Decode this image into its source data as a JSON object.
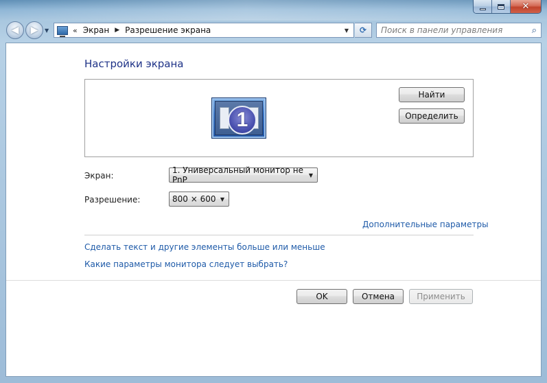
{
  "window": {
    "caption": {
      "minimize": "minimize",
      "maximize": "maximize",
      "close": "✕"
    }
  },
  "navbar": {
    "back_glyph": "◀",
    "forward_glyph": "▶",
    "address_root_sep": "«",
    "breadcrumbs": [
      "Экран",
      "Разрешение экрана"
    ],
    "crumb_arrow": "▶",
    "refresh_glyph": "⟳",
    "search_placeholder": "Поиск в панели управления",
    "search_glyph": "⌕"
  },
  "main": {
    "title": "Настройки экрана",
    "preview": {
      "monitor_number": "1",
      "find_label": "Найти",
      "identify_label": "Определить"
    },
    "screen": {
      "label": "Экран:",
      "value": "1. Универсальный монитор не PnP"
    },
    "resolution": {
      "label": "Разрешение:",
      "value": "800 × 600"
    },
    "advanced_link": "Дополнительные параметры",
    "links": {
      "text_size": "Сделать текст и другие элементы больше или меньше",
      "which_monitor": "Какие параметры монитора следует выбрать?"
    },
    "buttons": {
      "ok": "OK",
      "cancel": "Отмена",
      "apply": "Применить"
    }
  },
  "colors": {
    "title": "#1e3287",
    "link": "#1e5aa8",
    "disabled_text": "#8d8d8d"
  }
}
